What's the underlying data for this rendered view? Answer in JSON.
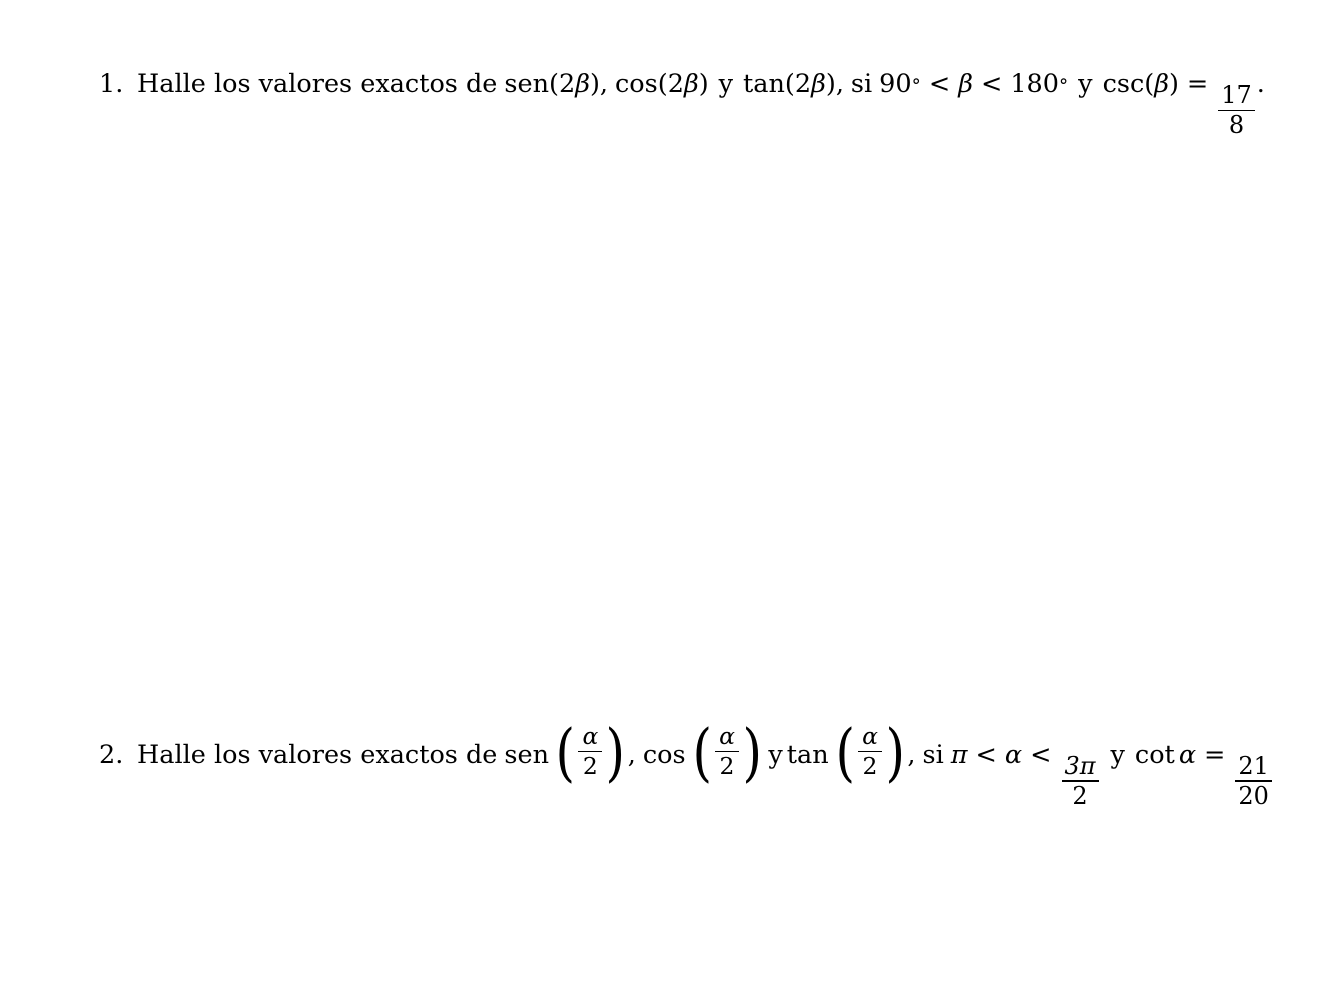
{
  "document": {
    "language": "es",
    "type": "math-worksheet",
    "background_color": "#ffffff",
    "text_color": "#000000"
  },
  "problems": [
    {
      "number": "1.",
      "lead": "Halle los valores exactos de",
      "func1": "sen",
      "arg1_open": "(",
      "arg1_coef": "2",
      "arg1_var": "β",
      "arg1_close": ")",
      "comma1": ",",
      "func2": "cos",
      "arg2_open": "(",
      "arg2_coef": "2",
      "arg2_var": "β",
      "arg2_close": ")",
      "conj1": "y",
      "func3": "tan",
      "arg3_open": "(",
      "arg3_coef": "2",
      "arg3_var": "β",
      "arg3_close": ")",
      "comma2": ",",
      "si": "si",
      "lower_bound": "90",
      "lower_degree": "°",
      "rel1": "<",
      "cond_var": "β",
      "rel2": "<",
      "upper_bound": "180",
      "upper_degree": "°",
      "conj2": "y",
      "given_func": "csc",
      "given_open": "(",
      "given_var": "β",
      "given_close": ")",
      "equals": "=",
      "value_numerator": "17",
      "value_denominator": "8",
      "period": "."
    },
    {
      "number": "2.",
      "lead": "Halle los valores exactos de",
      "func1": "sen",
      "arg1_open": "(",
      "arg1_numerator": "α",
      "arg1_denominator": "2",
      "arg1_close": ")",
      "comma1": ",",
      "func2": "cos",
      "arg2_open": "(",
      "arg2_numerator": "α",
      "arg2_denominator": "2",
      "arg2_close": ")",
      "conj1": "y",
      "func3": "tan",
      "arg3_open": "(",
      "arg3_numerator": "α",
      "arg3_denominator": "2",
      "arg3_close": ")",
      "comma2": ",",
      "si": "si",
      "lower_bound": "π",
      "rel1": "<",
      "cond_var": "α",
      "rel2": "<",
      "upper_numerator": "3π",
      "upper_denominator": "2",
      "conj2": "y",
      "given_func": "cot",
      "given_var": "α",
      "equals": "=",
      "value_numerator": "21",
      "value_denominator": "20"
    }
  ]
}
